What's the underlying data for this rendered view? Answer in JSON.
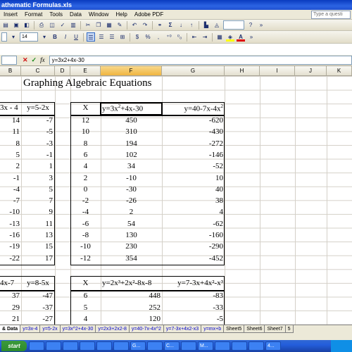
{
  "window": {
    "title": "athematic Formulas.xls"
  },
  "menu": {
    "items": [
      "Insert",
      "Format",
      "Tools",
      "Data",
      "Window",
      "Help",
      "Adobe PDF"
    ],
    "help_placeholder": "Type a questi"
  },
  "toolbar": {
    "zoom": "",
    "font_size": "14",
    "bold": "B",
    "italic": "I",
    "underline": "U",
    "sigma": "Σ",
    "currency": "$",
    "percent": "%",
    "comma": ",",
    "font_color": "A"
  },
  "formula_bar": {
    "name_box": "",
    "cancel": "✕",
    "enter": "✓",
    "fx": "fx",
    "formula": "y=3x2+4x-30"
  },
  "columns": [
    "B",
    "C",
    "D",
    "E",
    "F",
    "G",
    "H",
    "I",
    "J",
    "K"
  ],
  "sheet_title": "Graphing Algebraic Equations",
  "table1": {
    "col_b_header": "3x - 4",
    "col_c_header": "y=5-2x",
    "b": [
      "14",
      "11",
      "8",
      "5",
      "2",
      "-1",
      "-4",
      "-7",
      "-10",
      "-13",
      "-16",
      "-19",
      "-22"
    ],
    "c": [
      "-7",
      "-5",
      "-3",
      "-1",
      "1",
      "3",
      "5",
      "7",
      "9",
      "11",
      "13",
      "15",
      "17"
    ]
  },
  "table2": {
    "x_header": "X",
    "f_header_pre": "y=3x",
    "f_header_sup": "2",
    "f_header_post": "+4x-30",
    "g_header_pre": "y=40-7x-4x",
    "g_header_sup": "2",
    "x": [
      "12",
      "10",
      "8",
      "6",
      "4",
      "2",
      "0",
      "-2",
      "-4",
      "-6",
      "-8",
      "-10",
      "-12"
    ],
    "f": [
      "450",
      "310",
      "194",
      "102",
      "34",
      "-10",
      "-30",
      "-26",
      "2",
      "54",
      "130",
      "230",
      "354"
    ],
    "g": [
      "-620",
      "-430",
      "-272",
      "-146",
      "-52",
      "10",
      "40",
      "38",
      "4",
      "-62",
      "-160",
      "-290",
      "-452"
    ]
  },
  "table3": {
    "col_b_header": "4x-7",
    "col_c_header": "y=8-5x",
    "b": [
      "37",
      "29",
      "21"
    ],
    "c": [
      "-47",
      "-37",
      "-27"
    ]
  },
  "table4": {
    "x_header": "X",
    "f_header": "y=2x³+2x²-8x-8",
    "g_header": "y=7-3x+4x²-x³",
    "x": [
      "6",
      "5",
      "4"
    ],
    "f": [
      "448",
      "252",
      "120"
    ],
    "g": [
      "-83",
      "-33",
      "-5"
    ]
  },
  "tabs": [
    "& Data",
    "y=3x-4",
    "y=5-2x",
    "y=3x^2+4x-30",
    "y=2x3+2x2-8",
    "y=40-7x-4x^2",
    "y=7-3x+4x2-x3",
    "y=mx+b",
    "Sheet5",
    "Sheet6",
    "Sheet7",
    "5"
  ],
  "taskbar": {
    "start": "start",
    "buttons": [
      "",
      "",
      "",
      "",
      "",
      "",
      "G...",
      "",
      "C...",
      "",
      "M...",
      "",
      "",
      "",
      "4..."
    ]
  }
}
